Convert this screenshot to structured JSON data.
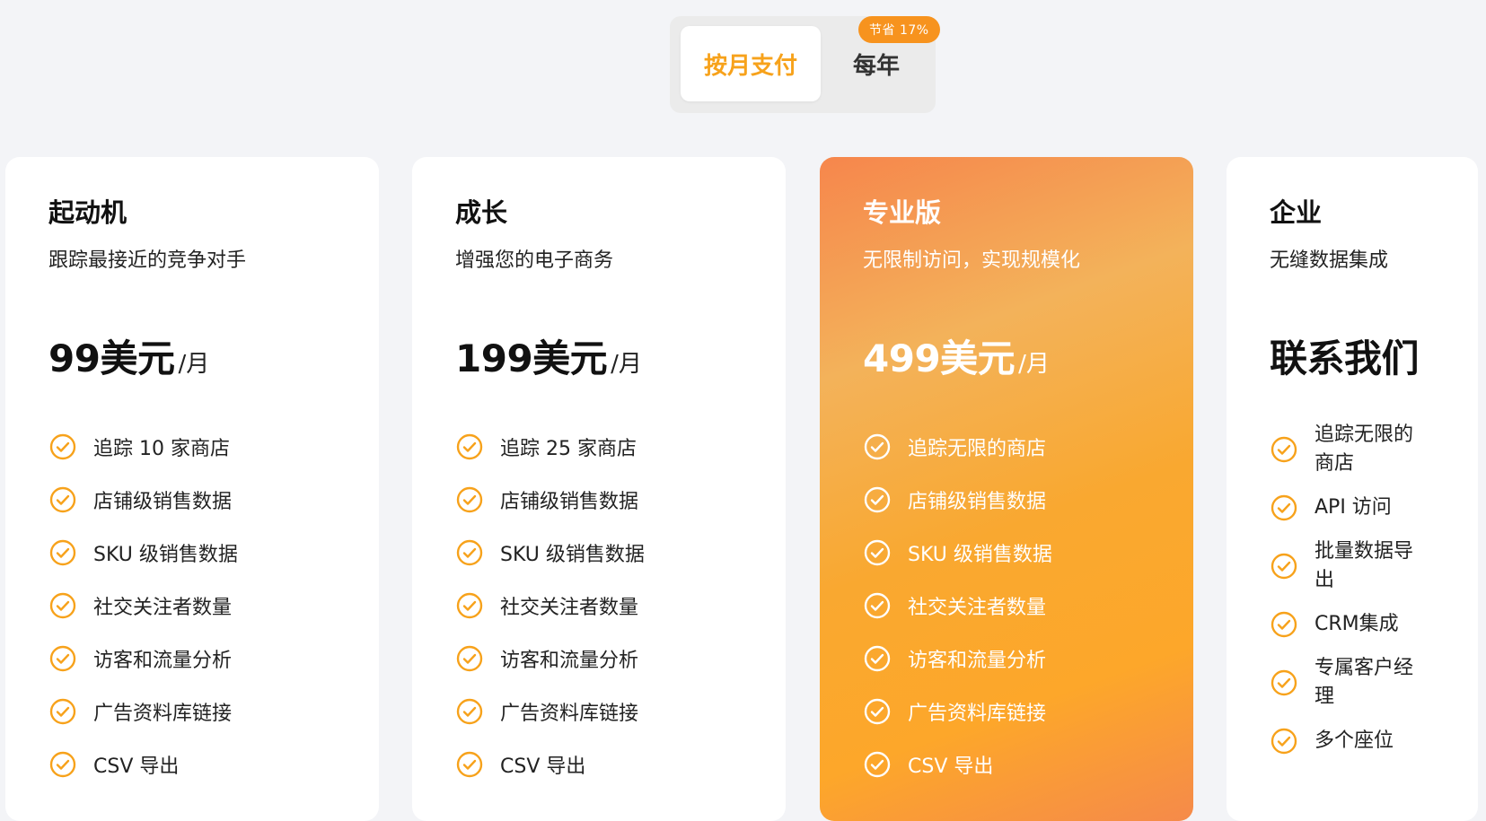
{
  "billing_toggle": {
    "monthly_label": "按月支付",
    "yearly_label": "每年",
    "save_badge": "节省 17%",
    "selected": "monthly"
  },
  "colors": {
    "accent": "#f7a21b",
    "badge": "#f7931e",
    "check": "#f7a21b"
  },
  "plans": [
    {
      "title": "起动机",
      "subtitle": "跟踪最接近的竞争对手",
      "price": "99美元",
      "period": "/月",
      "features": [
        "追踪 10 家商店",
        "店铺级销售数据",
        "SKU 级销售数据",
        "社交关注者数量",
        "访客和流量分析",
        "广告资料库链接",
        "CSV 导出"
      ]
    },
    {
      "title": "成长",
      "subtitle": "增强您的电子商务",
      "price": "199美元",
      "period": "/月",
      "features": [
        "追踪 25 家商店",
        "店铺级销售数据",
        "SKU 级销售数据",
        "社交关注者数量",
        "访客和流量分析",
        "广告资料库链接",
        "CSV 导出"
      ]
    },
    {
      "title": "专业版",
      "subtitle": "无限制访问，实现规模化",
      "price": "499美元",
      "period": "/月",
      "features": [
        "追踪无限的商店",
        "店铺级销售数据",
        "SKU 级销售数据",
        "社交关注者数量",
        "访客和流量分析",
        "广告资料库链接",
        "CSV 导出"
      ]
    },
    {
      "title": "企业",
      "subtitle": "无缝数据集成",
      "price": "联系我们",
      "period": "",
      "features": [
        "追踪无限的商店",
        "API 访问",
        "批量数据导出",
        "CRM集成",
        "专属客户经理",
        "多个座位"
      ]
    }
  ]
}
